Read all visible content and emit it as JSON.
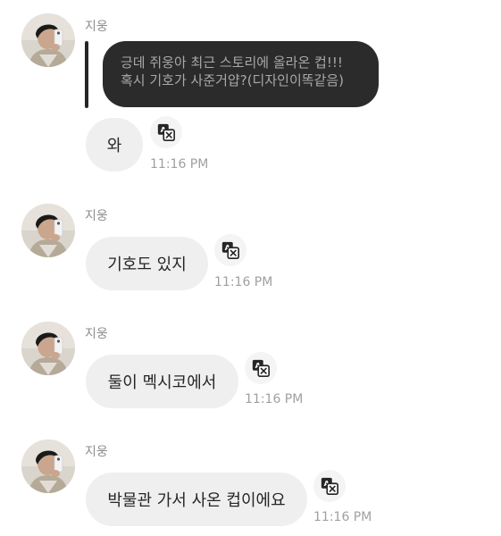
{
  "messages": [
    {
      "sender": "지웅",
      "quote_lines": [
        "긍데 쥐웅아 최근 스토리에 올라온 컵!!!",
        "혹시 기호가 사준거얍?(디자인이똑같음)"
      ],
      "text": "와",
      "time": "11:16 PM",
      "avatar_icon": "profile-photo",
      "translate_icon": "translate-icon"
    },
    {
      "sender": "지웅",
      "text": "기호도 있지",
      "time": "11:16 PM",
      "avatar_icon": "profile-photo",
      "translate_icon": "translate-icon"
    },
    {
      "sender": "지웅",
      "text": "둘이 멕시코에서",
      "time": "11:16 PM",
      "avatar_icon": "profile-photo",
      "translate_icon": "translate-icon"
    },
    {
      "sender": "지웅",
      "text": "박물관 가서 사온 컵이에요",
      "time": "11:16 PM",
      "avatar_icon": "profile-photo",
      "translate_icon": "translate-icon"
    }
  ],
  "colors": {
    "bubble_bg": "#efefef",
    "quote_bg": "#2b2b2b",
    "quote_text": "#a8a8a8",
    "meta_text": "#8e8e8e"
  }
}
